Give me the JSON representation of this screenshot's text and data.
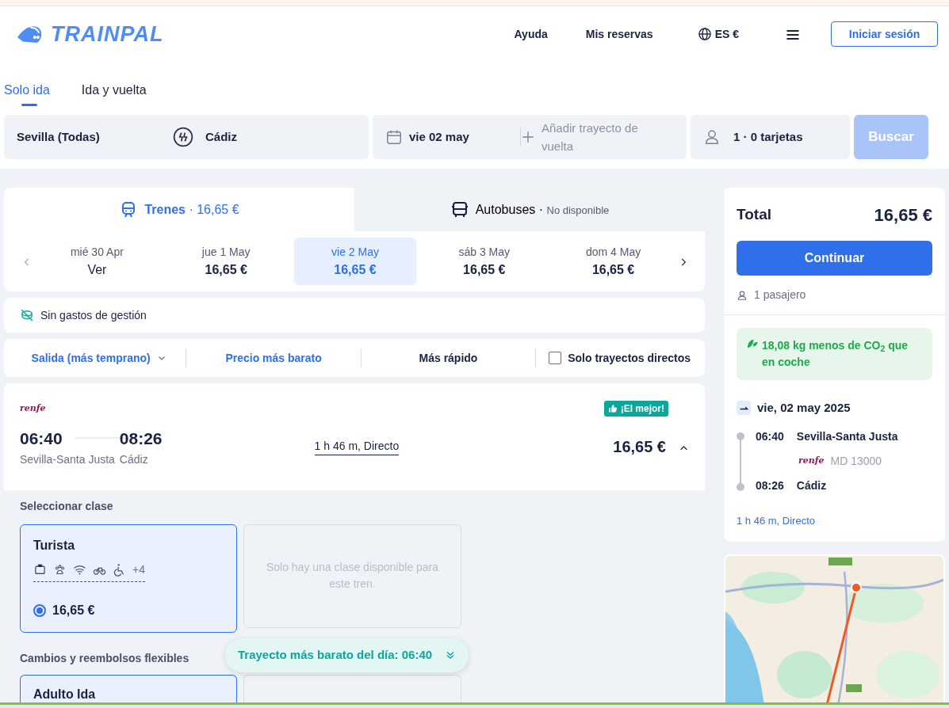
{
  "header": {
    "logo_text": "TRAINPAL",
    "nav": [
      "Ayuda",
      "Mis reservas"
    ],
    "locale": "ES €",
    "login": "Iniciar sesión"
  },
  "trip_tabs": [
    {
      "label": "Solo ida",
      "selected": true
    },
    {
      "label": "Ida y vuelta",
      "selected": false
    }
  ],
  "search": {
    "origin": "Sevilla (Todas)",
    "destination": "Cádiz",
    "date": "vie 02 may",
    "return_placeholder": "Añadir trayecto de vuelta",
    "passengers": "1 · 0 tarjetas",
    "button": "Buscar",
    "disabled": true
  },
  "mode_tabs": [
    {
      "kind": "train",
      "label": "Trenes",
      "separator": "·",
      "info": "16,65 €",
      "selected": true
    },
    {
      "kind": "bus",
      "label": "Autobuses",
      "separator": "·",
      "info": "No disponible",
      "selected": false
    }
  ],
  "dates": [
    {
      "day": "mié 30 Apr",
      "price": "Ver",
      "kind": "link",
      "selected": false
    },
    {
      "day": "jue 1 May",
      "price": "16,65 €",
      "kind": "price",
      "selected": false
    },
    {
      "day": "vie 2 May",
      "price": "16,65 €",
      "kind": "price",
      "selected": true
    },
    {
      "day": "sáb 3 May",
      "price": "16,65 €",
      "kind": "price",
      "selected": false
    },
    {
      "day": "dom 4 May",
      "price": "16,65 €",
      "kind": "price",
      "selected": false
    }
  ],
  "notice": "Sin gastos de gestión",
  "sort": [
    {
      "label": "Salida (más temprano)",
      "selected": true,
      "dropdown": true
    },
    {
      "label": "Precio más barato",
      "selected": true,
      "dropdown": false
    },
    {
      "label": "Más rápido",
      "selected": false,
      "dropdown": false
    }
  ],
  "direct_only": {
    "label": "Solo trayectos directos",
    "checked": false
  },
  "journey": {
    "operator": "renfe",
    "badge": "¡El mejor!",
    "depart_time": "06:40",
    "depart_station": "Sevilla-Santa Justa",
    "arrive_time": "08:26",
    "arrive_station": "Cádiz",
    "duration": "1 h 46 m, Directo",
    "price": "16,65 €",
    "expanded": true
  },
  "classes": {
    "title": "Seleccionar clase",
    "options": [
      {
        "name": "Turista",
        "extra": "+4",
        "price": "16,65 €",
        "selected": true
      }
    ],
    "note": "Solo hay una clase disponible para este tren."
  },
  "flexible": {
    "title": "Cambios y reembolsos flexibles",
    "options": [
      {
        "name": "Adulto Ida",
        "selected": true
      }
    ]
  },
  "toast": "Trayecto más barato del día: 06:40",
  "summary": {
    "total_label": "Total",
    "total": "16,65 €",
    "button": "Continuar",
    "passengers": "1 pasajero",
    "co2": "18,08 kg menos de CO$_{2}$ que en coche",
    "date": "vie, 02 may 2025",
    "stops": [
      {
        "time": "06:40",
        "station": "Sevilla-Santa Justa"
      },
      {
        "time": "08:26",
        "station": "Cádiz"
      }
    ],
    "train": {
      "operator": "renfe",
      "number": "MD 13000"
    },
    "duration": "1 h 46 m, Directo"
  }
}
